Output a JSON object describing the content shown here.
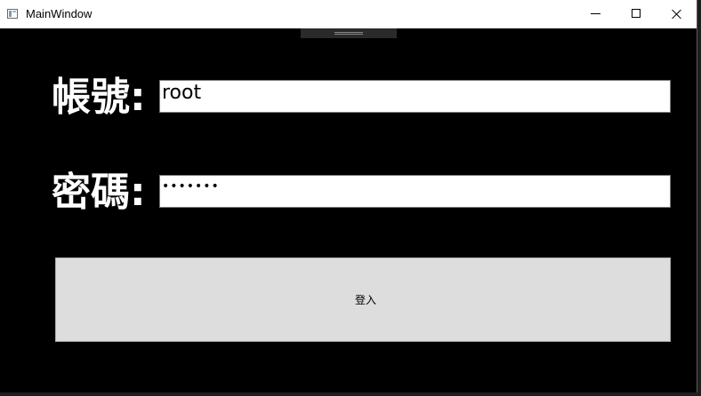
{
  "window": {
    "title": "MainWindow",
    "background": "#000000",
    "controls": {
      "minimize_icon": "minimize-icon",
      "maximize_icon": "maximize-icon",
      "close_icon": "close-icon"
    }
  },
  "form": {
    "username_label": "帳號:",
    "username_value": "root",
    "password_label": "密碼:",
    "password_value": "•••••••",
    "login_label": "登入"
  },
  "colors": {
    "label_text": "#ffffff",
    "input_bg": "#ffffff",
    "button_bg": "#dddddd"
  }
}
